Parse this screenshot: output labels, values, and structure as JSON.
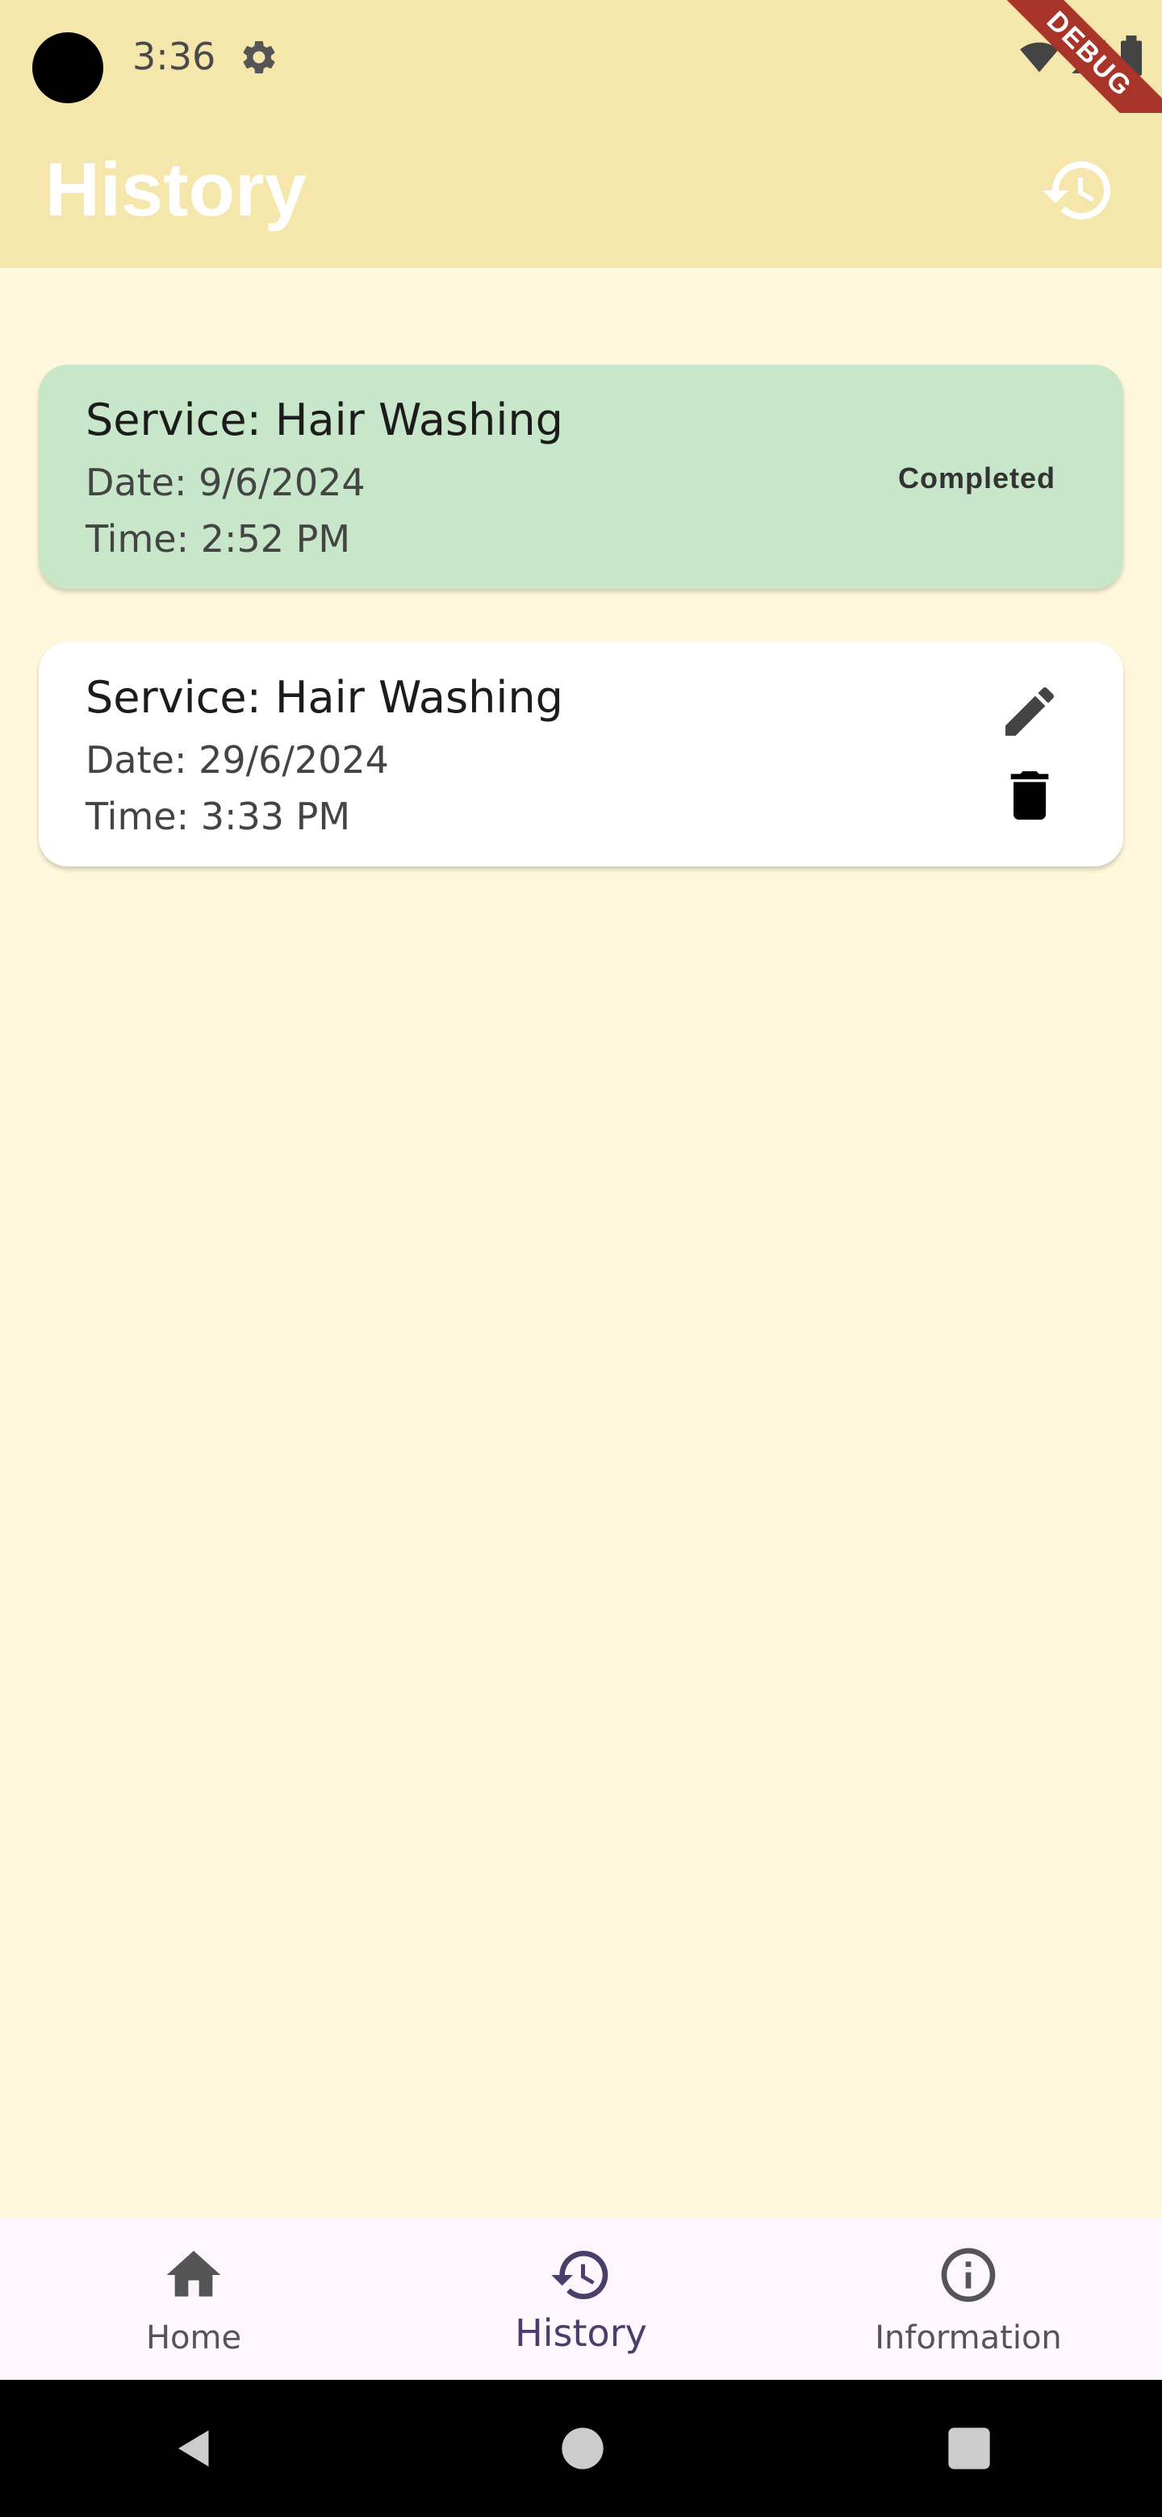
{
  "status_bar": {
    "time": "3:36"
  },
  "debug_banner": "DEBUG",
  "app_bar": {
    "title": "History"
  },
  "appointments": [
    {
      "service": "Service: Hair Washing",
      "date": "Date: 9/6/2024",
      "time": "Time: 2:52 PM",
      "status": "Completed"
    },
    {
      "service": "Service: Hair Washing",
      "date": "Date: 29/6/2024",
      "time": "Time: 3:33 PM"
    }
  ],
  "bottom_nav": {
    "items": [
      {
        "label": "Home",
        "icon": "home-icon"
      },
      {
        "label": "History",
        "icon": "history-icon",
        "active": true
      },
      {
        "label": "Information",
        "icon": "info-icon"
      }
    ]
  },
  "colors": {
    "app_bar": "#F5E6AB",
    "background": "#FFF8DC",
    "completed_card": "#C8E6C9",
    "active_nav": "#4A3F6B"
  }
}
